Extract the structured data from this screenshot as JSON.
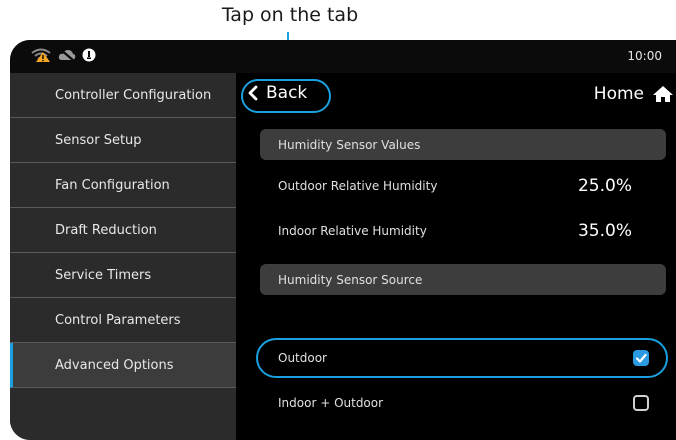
{
  "annotation": {
    "text": "Tap on the tab"
  },
  "status": {
    "time": "10:00",
    "icons": [
      "wifi-alert-icon",
      "cloud-off-icon",
      "info-icon"
    ]
  },
  "sidebar": {
    "items": [
      {
        "label": "Controller Configuration",
        "active": false
      },
      {
        "label": "Sensor Setup",
        "active": false
      },
      {
        "label": "Fan Configuration",
        "active": false
      },
      {
        "label": "Draft Reduction",
        "active": false
      },
      {
        "label": "Service Timers",
        "active": false
      },
      {
        "label": "Control Parameters",
        "active": false
      },
      {
        "label": "Advanced Options",
        "active": true
      }
    ]
  },
  "header": {
    "back_label": "Back",
    "home_label": "Home"
  },
  "sections": {
    "values": {
      "title": "Humidity Sensor Values",
      "rows": [
        {
          "label": "Outdoor Relative Humidity",
          "value": "25.0%"
        },
        {
          "label": "Indoor Relative Humidity",
          "value": "35.0%"
        }
      ]
    },
    "source": {
      "title": "Humidity Sensor Source",
      "options": [
        {
          "label": "Outdoor",
          "checked": true
        },
        {
          "label": "Indoor + Outdoor",
          "checked": false
        }
      ]
    }
  },
  "colors": {
    "accent": "#1aa0e0",
    "checkbox": "#2a9be0",
    "sidebar": "#2b2b2b",
    "background": "#000000"
  }
}
